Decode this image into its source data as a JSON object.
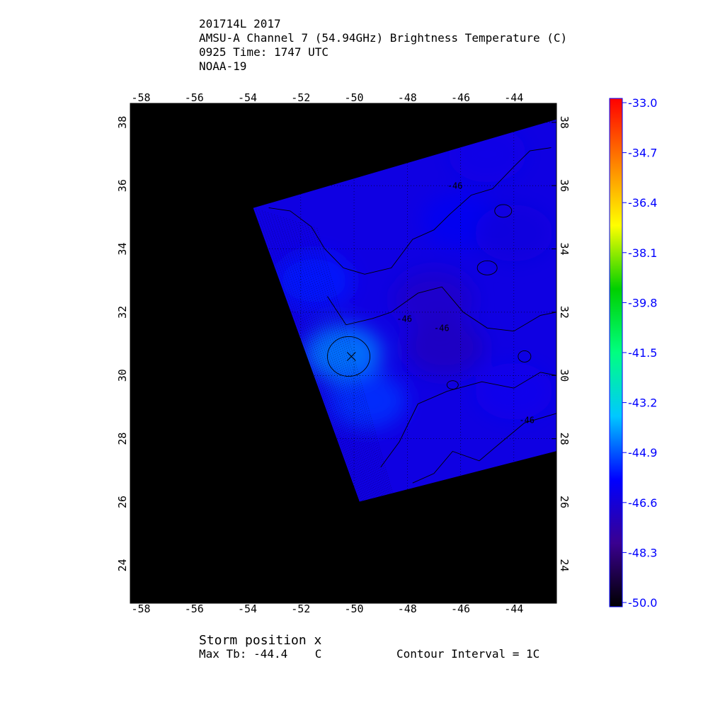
{
  "header": {
    "line1": "201714L 2017",
    "line2": "AMSU-A Channel 7 (54.94GHz) Brightness Temperature (C)",
    "line3": "0925 Time: 1747 UTC",
    "line4": "NOAA-19"
  },
  "footer": {
    "storm_position": "Storm position x",
    "max_tb": "Max Tb: -44.4    C",
    "contour_interval": "Contour Interval = 1C"
  },
  "chart_data": {
    "type": "heatmap",
    "title": "AMSU-A Channel 7 (54.94GHz) Brightness Temperature (C)",
    "x_axis": {
      "range": [
        -58.4,
        -42.4
      ],
      "ticks": [
        -58,
        -56,
        -54,
        -52,
        -50,
        -48,
        -46,
        -44
      ]
    },
    "y_axis": {
      "range": [
        22.8,
        38.6
      ],
      "ticks": [
        24,
        26,
        28,
        30,
        32,
        34,
        36,
        38
      ]
    },
    "grid": true,
    "background_no_data": "#000000",
    "swath_polygon": [
      [
        -53.8,
        35.3
      ],
      [
        -42.4,
        38.1
      ],
      [
        -42.4,
        27.6
      ],
      [
        -49.8,
        26.0
      ]
    ],
    "storm_position": {
      "lon": -50.1,
      "lat": 30.6,
      "marker": "x"
    },
    "max_tb": -44.4,
    "contour_interval": 1,
    "contour_labels": [
      {
        "text": "-46",
        "lon": -46.5,
        "lat": 35.9
      },
      {
        "text": "-46",
        "lon": -48.4,
        "lat": 31.7
      },
      {
        "text": "-46",
        "lon": -47.0,
        "lat": 31.4
      },
      {
        "text": "-46",
        "lon": -43.8,
        "lat": 28.5
      }
    ],
    "field_samples": [
      {
        "lon": -50.4,
        "lat": 30.7,
        "value": -44.4
      },
      {
        "lon": -49.5,
        "lat": 29.2,
        "value": -45.2
      },
      {
        "lon": -51.5,
        "lat": 33.0,
        "value": -45.5
      },
      {
        "lon": -47.0,
        "lat": 32.4,
        "value": -46.8
      },
      {
        "lon": -46.6,
        "lat": 30.9,
        "value": -47.0
      },
      {
        "lon": -46.0,
        "lat": 34.9,
        "value": -46.0
      },
      {
        "lon": -44.0,
        "lat": 34.5,
        "value": -46.4
      },
      {
        "lon": -44.0,
        "lat": 29.5,
        "value": -46.1
      },
      {
        "lon": -45.0,
        "lat": 37.0,
        "value": -46.2
      }
    ],
    "colorbar": {
      "min": -50.0,
      "max": -33.0,
      "labels": [
        "-33.0",
        "-34.7",
        "-36.4",
        "-38.1",
        "-39.8",
        "-41.5",
        "-43.2",
        "-44.9",
        "-46.6",
        "-48.3",
        "-50.0"
      ],
      "label_color": "#0000ff",
      "stops": [
        "#000000",
        "#3a0090",
        "#0000ff",
        "#00c8ff",
        "#00ff80",
        "#00d000",
        "#ffff00",
        "#ff8000",
        "#ff0000"
      ]
    }
  }
}
